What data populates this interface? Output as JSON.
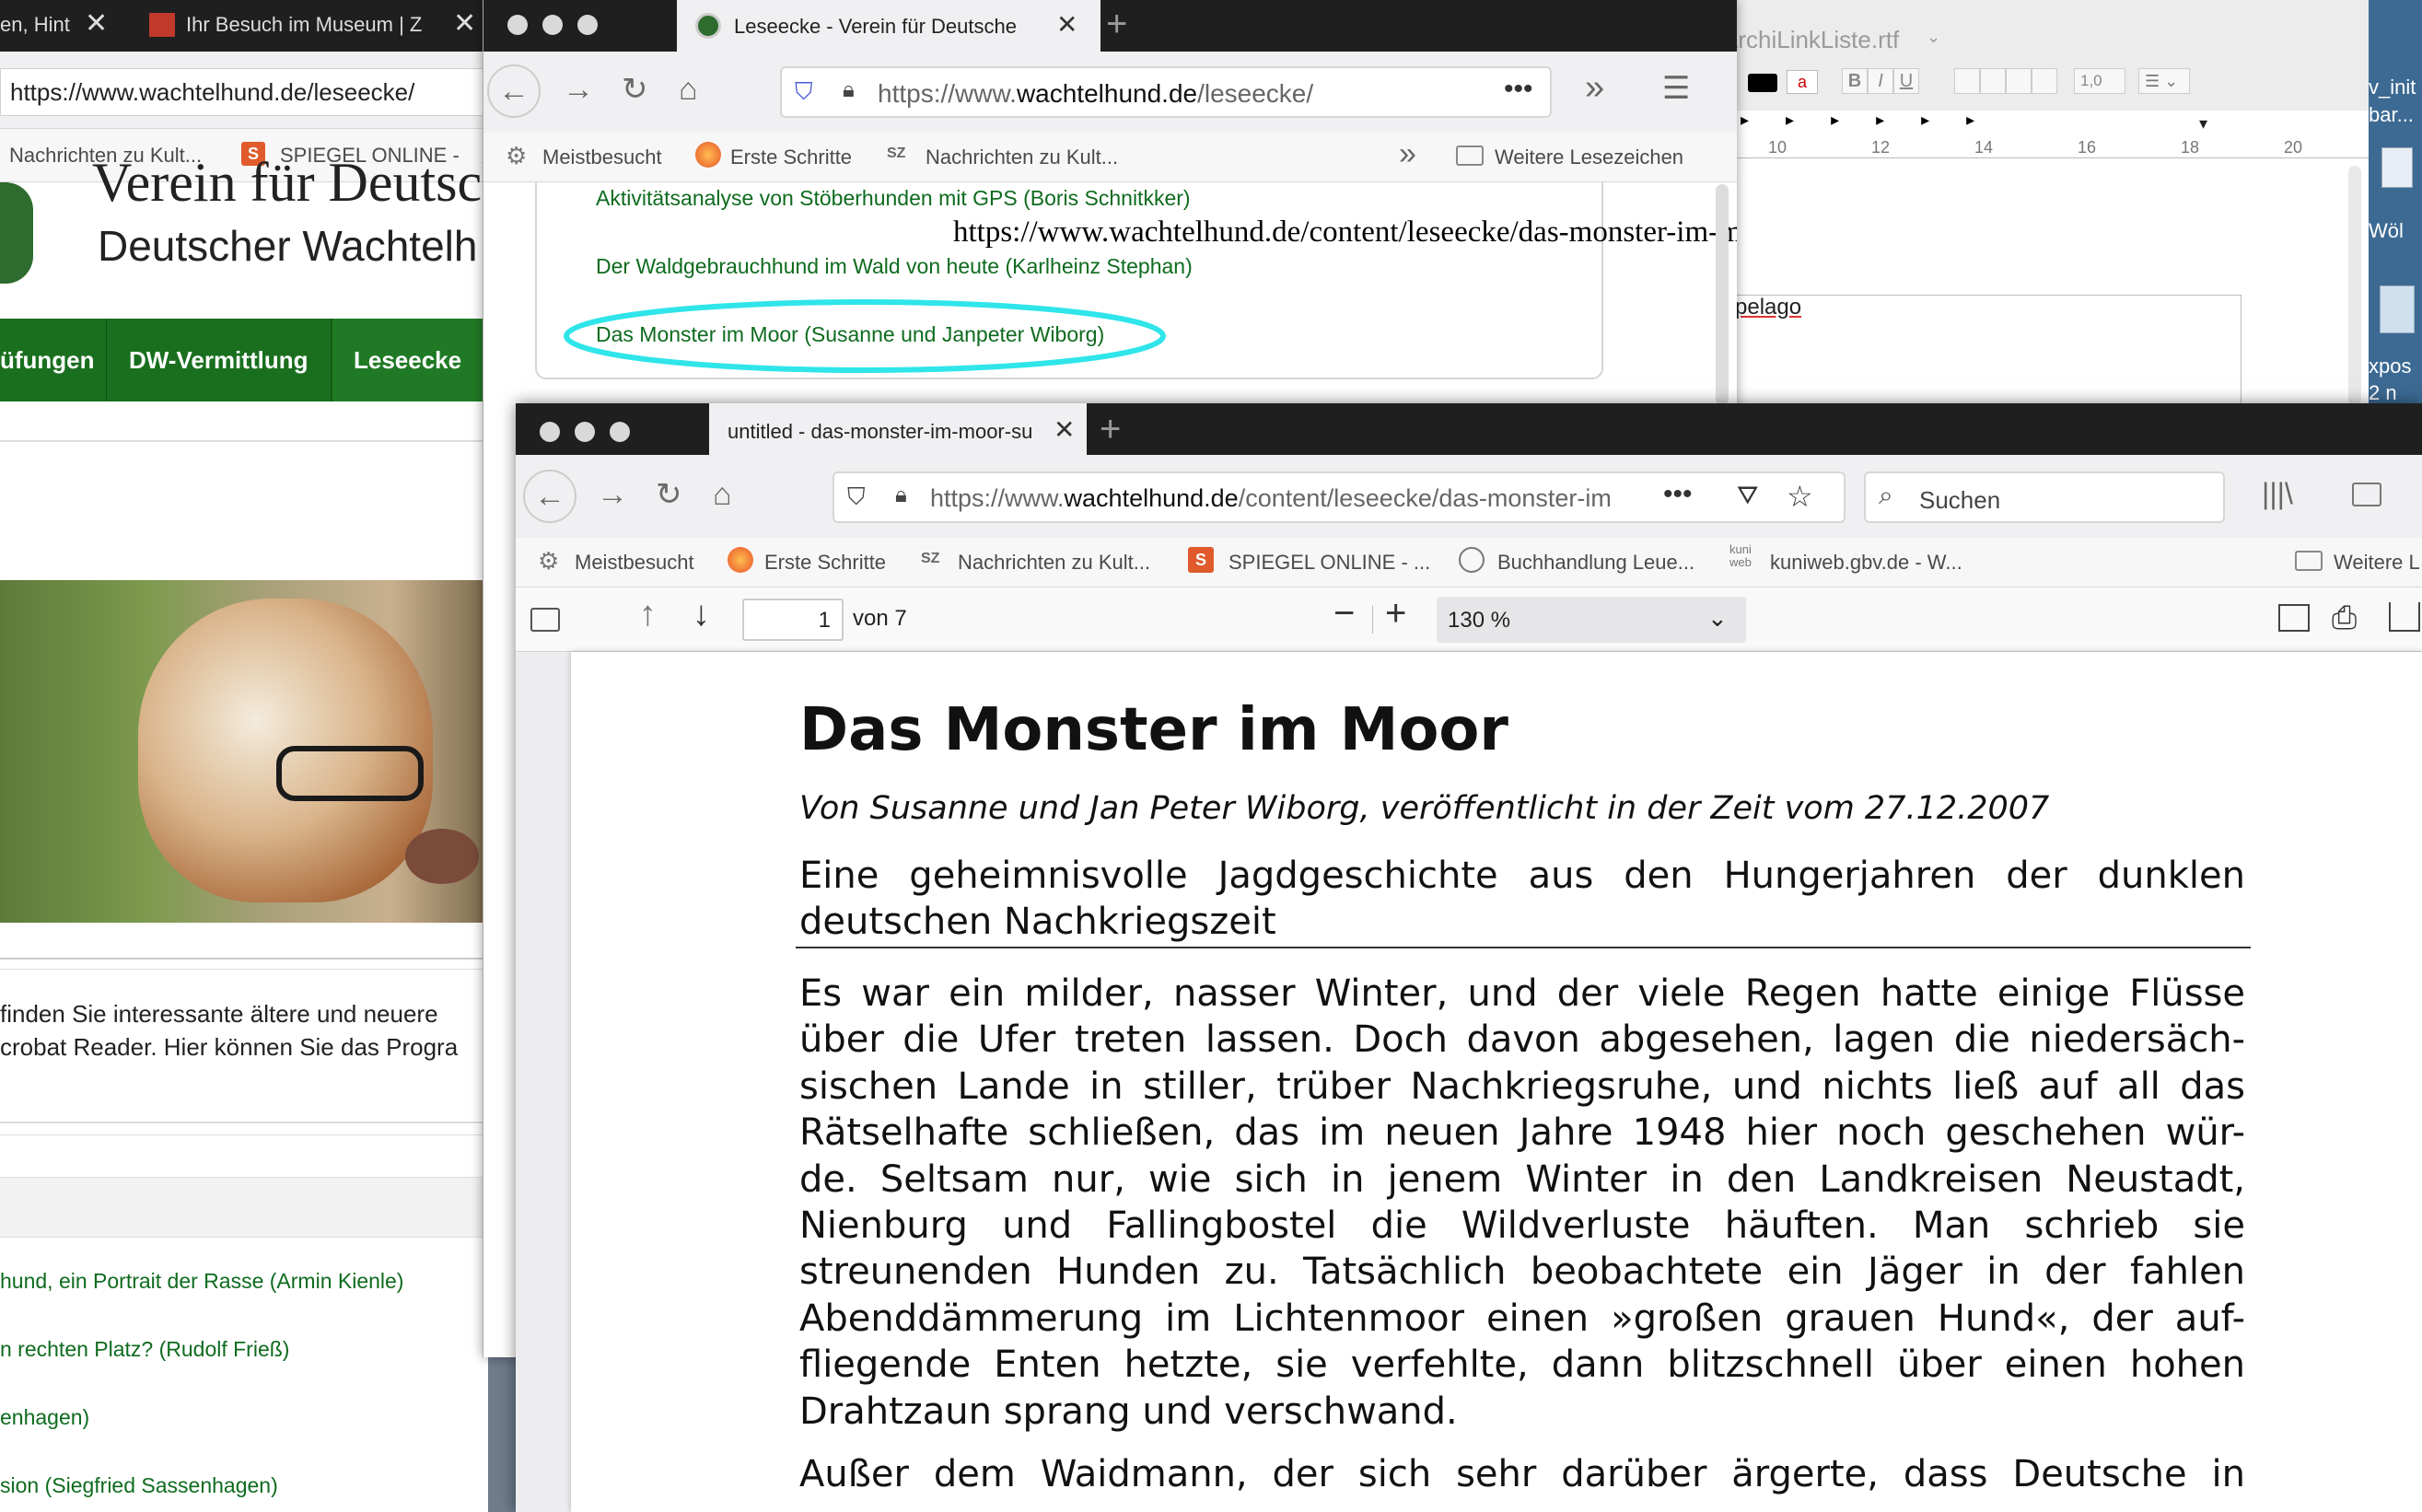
{
  "left_window": {
    "tab1_label": "en, Hint",
    "tab2_label": "Ihr Besuch im Museum | Z",
    "url": "https://www.wachtelhund.de/leseecke/",
    "bookmarks": [
      "Nachrichten zu Kult...",
      "SPIEGEL ONLINE -"
    ],
    "site_logo_text": "Verein für Deutsche",
    "site_subtitle": "Deutscher Wachtelh",
    "nav": [
      "üfungen",
      "DW-Vermittlung",
      "Leseecke"
    ],
    "intro_line1": "finden Sie interessante ältere und neuere",
    "intro_line2": "crobat Reader. Hier können Sie das Progra",
    "links": [
      "hund, ein Portrait der Rasse (Armin Kienle)",
      "n rechten Platz? (Rudolf Frieß)",
      "enhagen)",
      "sion (Siegfried Sassenhagen)"
    ]
  },
  "middle_window": {
    "tab_label": "Leseecke - Verein für Deutsche",
    "url_prefix": "https://www.",
    "url_domain": "wachtelhund.de",
    "url_suffix": "/leseecke/",
    "bookmarks": [
      "Meistbesucht",
      "Erste Schritte",
      "Nachrichten zu Kult..."
    ],
    "more_bookmarks": "Weitere Lesezeichen",
    "links": [
      "Aktivitätsanalyse von Stöberhunden mit GPS (Boris Schnitkker)",
      "Der Waldgebrauchhund im Wald von heute (Karlheinz Stephan)",
      "Das Monster im Moor (Susanne und Janpeter Wiborg)"
    ],
    "tooltip_url": "https://www.wachtelhund.de/content/leseecke/das-monster-im-moor-susanne-und-janpeter-wiborg.pdf"
  },
  "right_window": {
    "title": "ArchiLinkListe.rtf",
    "line_spacing": "1,0",
    "ruler_numbers": [
      "10",
      "12",
      "14",
      "16",
      "18",
      "20"
    ],
    "doc_text": "pelago"
  },
  "desktop": {
    "label1": "v_init",
    "label2": "bar...",
    "label3": "Wöl",
    "label4": "xpos",
    "label5": "2 n"
  },
  "front_window": {
    "tab_label": "untitled - das-monster-im-moor-su",
    "url_prefix": "https://www.",
    "url_domain": "wachtelhund.de",
    "url_suffix": "/content/leseecke/das-monster-im",
    "search_placeholder": "Suchen",
    "bookmarks": [
      "Meistbesucht",
      "Erste Schritte",
      "Nachrichten zu Kult...",
      "SPIEGEL ONLINE - ...",
      "Buchhandlung Leue...",
      "kuniweb.gbv.de - W..."
    ],
    "more_bookmarks": "Weitere L",
    "pdf": {
      "page_number": "1",
      "page_count": "von 7",
      "zoom": "130 %",
      "title": "Das Monster im Moor",
      "byline": "Von Susanne und Jan Peter Wiborg, veröffentlicht in der Zeit vom 27.12.2007",
      "subtitle_line1": "Eine geheimnisvolle Jagdgeschichte aus den Hungerjahren der dunklen",
      "subtitle_line2": "deutschen Nachkriegszeit",
      "body_lines": [
        "Es war ein milder, nasser Winter, und der viele Regen hatte einige Flüsse",
        "über die Ufer treten lassen. Doch davon abgesehen, lagen die niedersäch-",
        "sischen Lande in stiller, trüber Nachkriegsruhe, und nichts ließ auf all das",
        "Rätselhafte schließen, das im neuen Jahre 1948 hier noch geschehen wür-",
        "de. Seltsam nur, wie sich in jenem Winter in den Landkreisen Neustadt,",
        "Nienburg und Fallingbostel die Wildverluste häuften. Man schrieb sie",
        "streunenden Hunden zu. Tatsächlich beobachtete ein Jäger in der fahlen",
        "Abenddämmerung im Lichtenmoor einen »großen grauen Hund«, der auf-",
        "fliegende Enten hetzte, sie verfehlte, dann blitzschnell über einen hohen",
        "Drahtzaun sprang und verschwand.",
        "Außer dem Waidmann, der sich sehr darüber ärgerte, dass Deutsche in"
      ]
    }
  }
}
